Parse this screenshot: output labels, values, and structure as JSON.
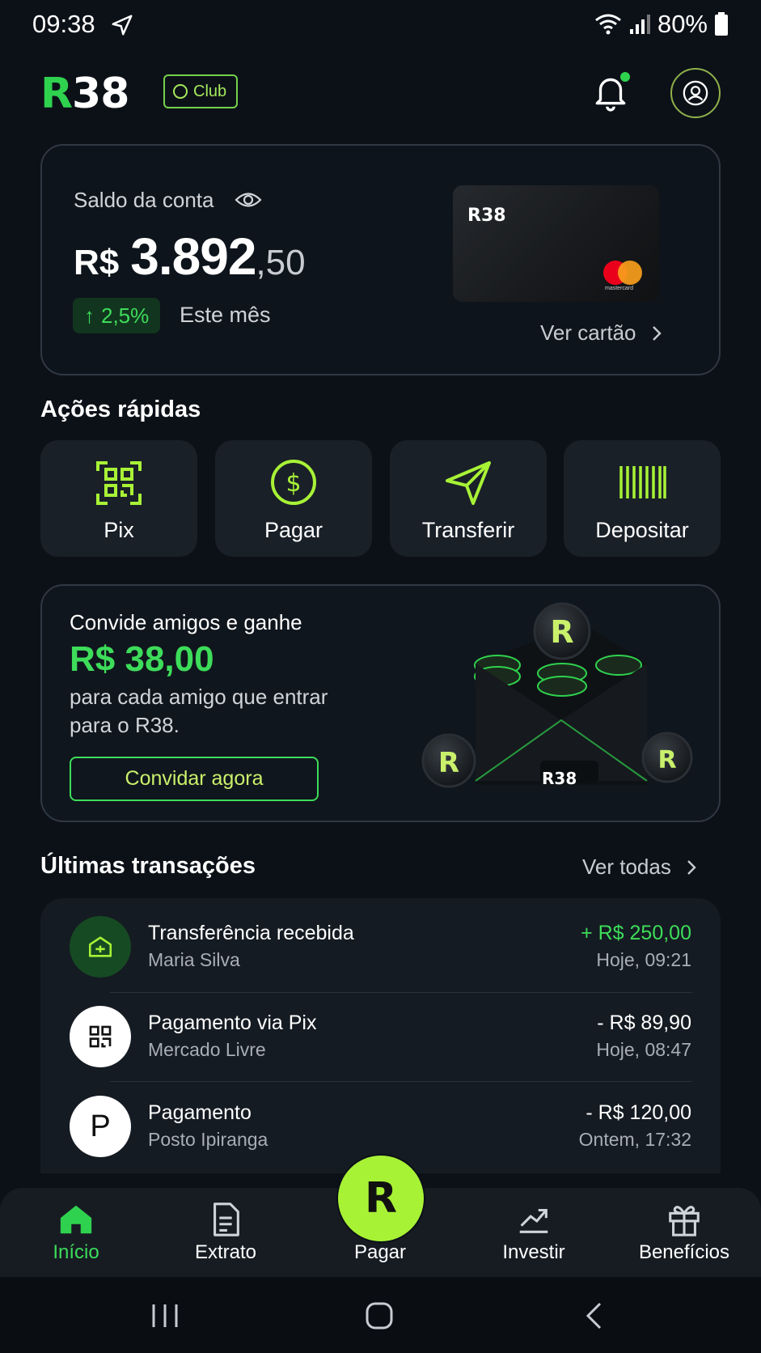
{
  "status_bar": {
    "time": "09:38",
    "battery": "80%"
  },
  "header": {
    "logo": "R38",
    "club_label": "Club"
  },
  "balance": {
    "label": "Saldo da conta",
    "currency": "R$",
    "integer": "3.892",
    "cents": ",50",
    "change": "2,5%",
    "change_period": "Este mês",
    "card_logo": "R38",
    "card_brand_text": "mastercard",
    "view_card": "Ver cartão"
  },
  "quick_actions": {
    "title": "Ações rápidas",
    "items": [
      {
        "label": "Pix",
        "icon": "pix-qr-icon"
      },
      {
        "label": "Pagar",
        "icon": "dollar-circle-icon"
      },
      {
        "label": "Transferir",
        "icon": "send-icon"
      },
      {
        "label": "Depositar",
        "icon": "barcode-icon"
      }
    ]
  },
  "referral": {
    "title": "Convide amigos e ganhe",
    "amount": "R$ 38,00",
    "desc_line1": "para cada amigo que entrar",
    "desc_line2": "para o R38.",
    "button": "Convidar agora",
    "envelope_logo": "R38"
  },
  "transactions": {
    "title": "Últimas transações",
    "view_all": "Ver todas",
    "items": [
      {
        "name": "Transferência recebida",
        "sub": "Maria Silva",
        "amount": "+ R$ 250,00",
        "time": "Hoje, 09:21",
        "positive": true
      },
      {
        "name": "Pagamento via Pix",
        "sub": "Mercado Livre",
        "amount": "- R$ 89,90",
        "time": "Hoje, 08:47",
        "positive": false
      },
      {
        "name": "Pagamento",
        "sub": "Posto Ipiranga",
        "amount": "- R$ 120,00",
        "time": "Ontem, 17:32",
        "positive": false,
        "icon_letter": "P"
      }
    ]
  },
  "bottom_nav": {
    "items": [
      {
        "label": "Início",
        "active": true
      },
      {
        "label": "Extrato"
      },
      {
        "label": "Pagar",
        "fab_letter": "R"
      },
      {
        "label": "Investir"
      },
      {
        "label": "Benefícios"
      }
    ]
  },
  "colors": {
    "accent_green": "#3ddc5a",
    "lime": "#a8f236",
    "background": "#0c1118"
  }
}
